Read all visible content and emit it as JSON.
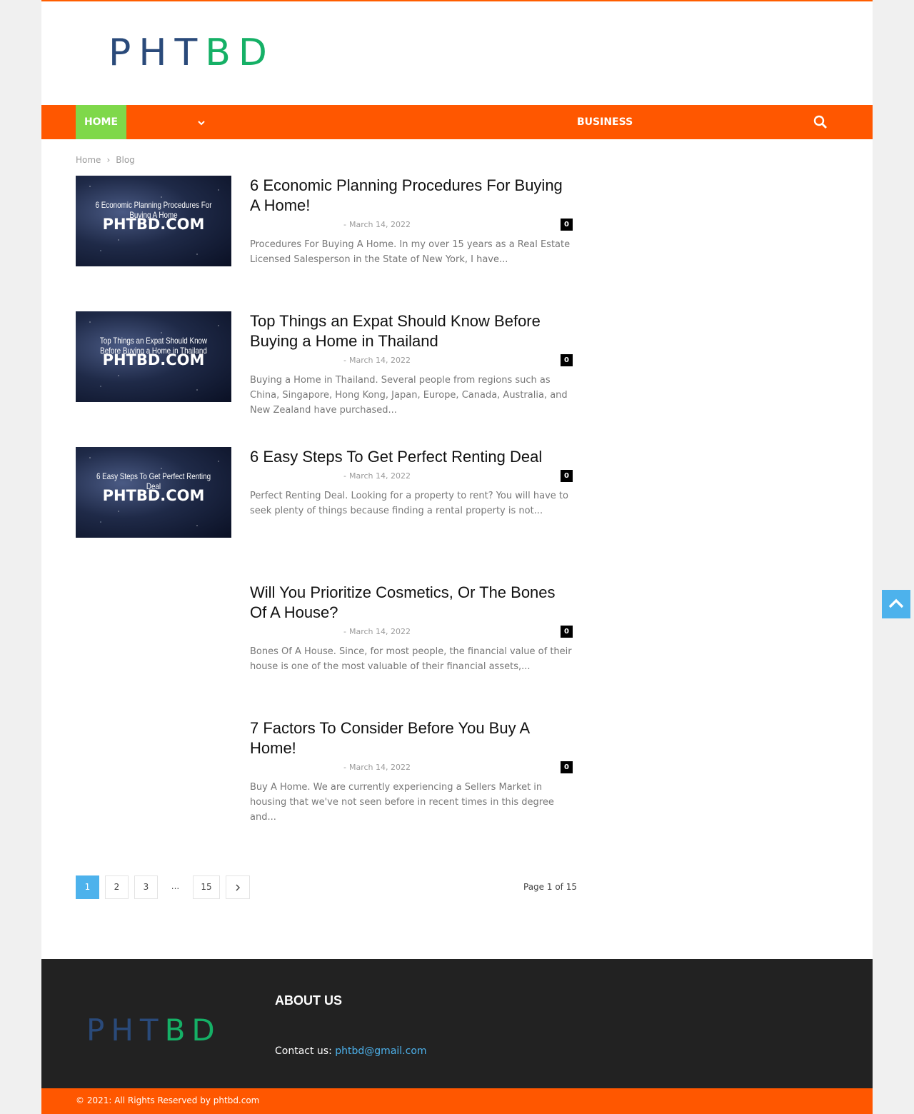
{
  "brand": {
    "logo_part1": "PHT",
    "logo_part2": "BD",
    "accent": "#ff5700",
    "active_nav": "#7fd84a",
    "link": "#4db2ec"
  },
  "nav": {
    "home_label": "HOME",
    "dropdown_icon": "chevron-down-icon",
    "business_label": "BUSINESS",
    "search_icon": "search-icon"
  },
  "breadcrumb": {
    "home": "Home",
    "separator": "›",
    "current": "Blog"
  },
  "posts": [
    {
      "thumb_caption": "6 Economic Planning Procedures For Buying A Home",
      "thumb_site": "PHTBD.COM",
      "title": "6 Economic Planning Procedures For Buying A Home!",
      "dash": "-",
      "date": "March 14, 2022",
      "comments": "0",
      "excerpt": "Procedures For Buying A Home. In my over 15 years as a Real Estate Licensed Salesperson in the State of New York, I have..."
    },
    {
      "thumb_caption": "Top Things an Expat Should Know Before Buying a Home in Thailand",
      "thumb_site": "PHTBD.COM",
      "title": "Top Things an Expat Should Know Before Buying a Home in Thailand",
      "dash": "-",
      "date": "March 14, 2022",
      "comments": "0",
      "excerpt": "Buying a Home in Thailand. Several people from regions such as China, Singapore, Hong Kong, Japan, Europe, Canada, Australia, and New Zealand have purchased..."
    },
    {
      "thumb_caption": "6 Easy Steps To Get Perfect Renting Deal",
      "thumb_site": "PHTBD.COM",
      "title": "6 Easy Steps To Get Perfect Renting Deal",
      "dash": "-",
      "date": "March 14, 2022",
      "comments": "0",
      "excerpt": "Perfect Renting Deal. Looking for a property to rent? You will have to seek plenty of things because finding a rental property is not..."
    },
    {
      "title": "Will You Prioritize Cosmetics, Or The Bones Of A House?",
      "dash": "-",
      "date": "March 14, 2022",
      "comments": "0",
      "excerpt": "Bones Of A House. Since, for most people, the financial value of their house is one of the most valuable of their financial assets,..."
    },
    {
      "title": "7 Factors To Consider Before You Buy A Home!",
      "dash": "-",
      "date": "March 14, 2022",
      "comments": "0",
      "excerpt": "Buy A Home. We are currently experiencing a Sellers Market in housing that we've not seen before in recent times in this degree and..."
    }
  ],
  "pagination": {
    "pages": [
      "1",
      "2",
      "3",
      "...",
      "15"
    ],
    "next_icon": "chevron-right-icon",
    "summary": "Page 1 of 15"
  },
  "back_to_top_icon": "chevron-up-icon",
  "footer": {
    "logo_part1": "PHT",
    "logo_part2": "BD",
    "about_heading": "ABOUT US",
    "contact_label": "Contact us: ",
    "contact_email": "phtbd@gmail.com",
    "copyright": "© 2021: All Rights Reserved by phtbd.com"
  }
}
